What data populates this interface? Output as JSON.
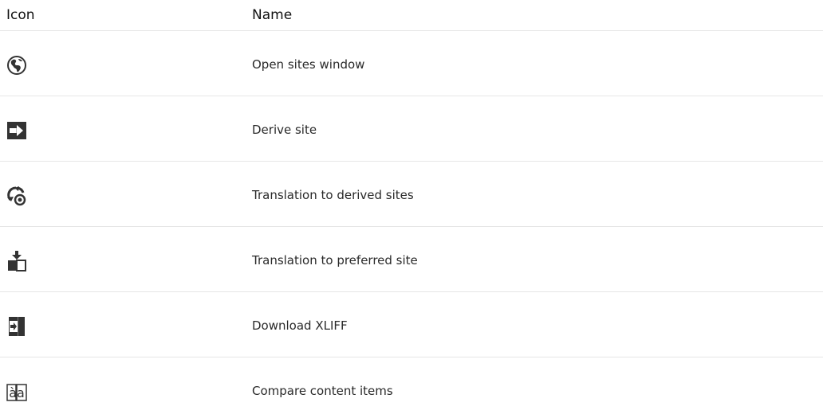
{
  "table": {
    "headers": {
      "icon": "Icon",
      "name": "Name"
    },
    "rows": [
      {
        "icon": "globe-icon",
        "name": "Open sites window"
      },
      {
        "icon": "derive-site-icon",
        "name": "Derive site"
      },
      {
        "icon": "translation-derived-sites-icon",
        "name": "Translation to derived sites"
      },
      {
        "icon": "translation-preferred-site-icon",
        "name": "Translation to preferred site"
      },
      {
        "icon": "download-xliff-icon",
        "name": "Download XLIFF"
      },
      {
        "icon": "compare-content-items-icon",
        "name": "Compare content items"
      }
    ],
    "compare_icon_text": "àa"
  }
}
